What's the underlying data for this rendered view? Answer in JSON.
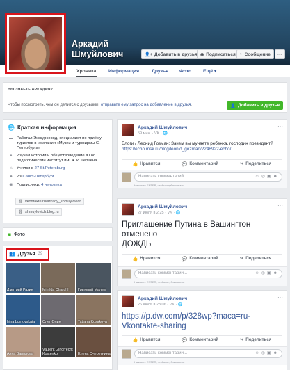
{
  "profile": {
    "name_line1": "Аркадий",
    "name_line2": "Шмуйлович",
    "add_friend_label": "Добавить в друзья",
    "subscribe_label": "Подписаться",
    "message_label": "Сообщение",
    "more_label": "···"
  },
  "tabs": [
    {
      "label": "Хроника"
    },
    {
      "label": "Информация"
    },
    {
      "label": "Друзья"
    },
    {
      "label": "Фото"
    },
    {
      "label": "Ещё ▾"
    }
  ],
  "pymk": {
    "title": "ВЫ ЗНАЕТЕ АРКАДИЯ?",
    "text_prefix": "Чтобы посмотреть, чем он делится с друзьями, ",
    "text_link": "отправьте ему запрос на добавление в друзья",
    "text_suffix": ".",
    "button": "Добавить в друзья"
  },
  "intro": {
    "title": "Краткая информация",
    "items": [
      {
        "icon": "briefcase-icon",
        "text": "Работал Экскурсовод, специалист по приёму туристов в компании «Музеи и турфирмы С.-Петербурга»"
      },
      {
        "icon": "graduation-cap-icon",
        "text": "Изучал истории и обществоведение в Гос. педагогический институт им. А. И. Герцена"
      },
      {
        "icon": "home-icon",
        "text_prefix": "Учился в ",
        "link": "27 St.Petersburg"
      },
      {
        "icon": "map-pin-icon",
        "text_prefix": "Из ",
        "link": "Санкт-Петербург"
      },
      {
        "icon": "rss-icon",
        "text_prefix": "Подписчики: ",
        "link": "4 человека"
      }
    ],
    "links": [
      "vkontakte.ru/arkady_shmuylovich",
      "shmuylovich.blog.ru"
    ]
  },
  "photos": {
    "title": "Фото"
  },
  "friends": {
    "title": "Друзья",
    "count": "39",
    "people": [
      {
        "name": "Дмитрий Разин",
        "bg": "#3a5f86"
      },
      {
        "name": "Mirrilda Charuhl",
        "bg": "#7a6a5a"
      },
      {
        "name": "Григорий Малев",
        "bg": "#4a5560"
      },
      {
        "name": "Irina Lomovskaja",
        "bg": "#2d5a8a"
      },
      {
        "name": "Олег Олин",
        "bg": "#6d6a70"
      },
      {
        "name": "Tatiana Kosakova",
        "bg": "#8a7460"
      },
      {
        "name": "Анна Варилова",
        "bg": "#b79a86"
      },
      {
        "name": "Vaulent Ginorrecht Kostenko",
        "bg": "#3c3c3c"
      },
      {
        "name": "Елена Очеретнина",
        "bg": "#6a5040"
      }
    ]
  },
  "posts": [
    {
      "author": "Аркадий Шмуйлович",
      "meta": "59 мин. · VK · 🌐",
      "text": "Блоги / Леонид Гозман: Зачем вы мучаете ребенка, господин президент?",
      "link": "https://echo.msk.ru/blog/leonid_gozman/2248922-echo/..."
    },
    {
      "author": "Аркадий Шмуйлович",
      "meta": "27 июля в 2:25 · VK · 🌐",
      "big_text_1": "Приглашение Путина в Вашингтон",
      "big_text_2": "отменено",
      "big_text_3": "ДОЖДЬ"
    },
    {
      "author": "Аркадий Шмуйлович",
      "meta": "26 июля в 23:06 · VK · 🌐",
      "big_text_1": "https://p.dw.com/p/328wp?maca=ru-",
      "big_text_2": "Vkontakte-sharing"
    }
  ],
  "actions": {
    "like": "Нравится",
    "comment": "Комментарий",
    "share": "Поделиться"
  },
  "comment": {
    "placeholder": "Написать комментарий...",
    "hint": "Нажмите ENTER, чтобы опубликовать."
  }
}
